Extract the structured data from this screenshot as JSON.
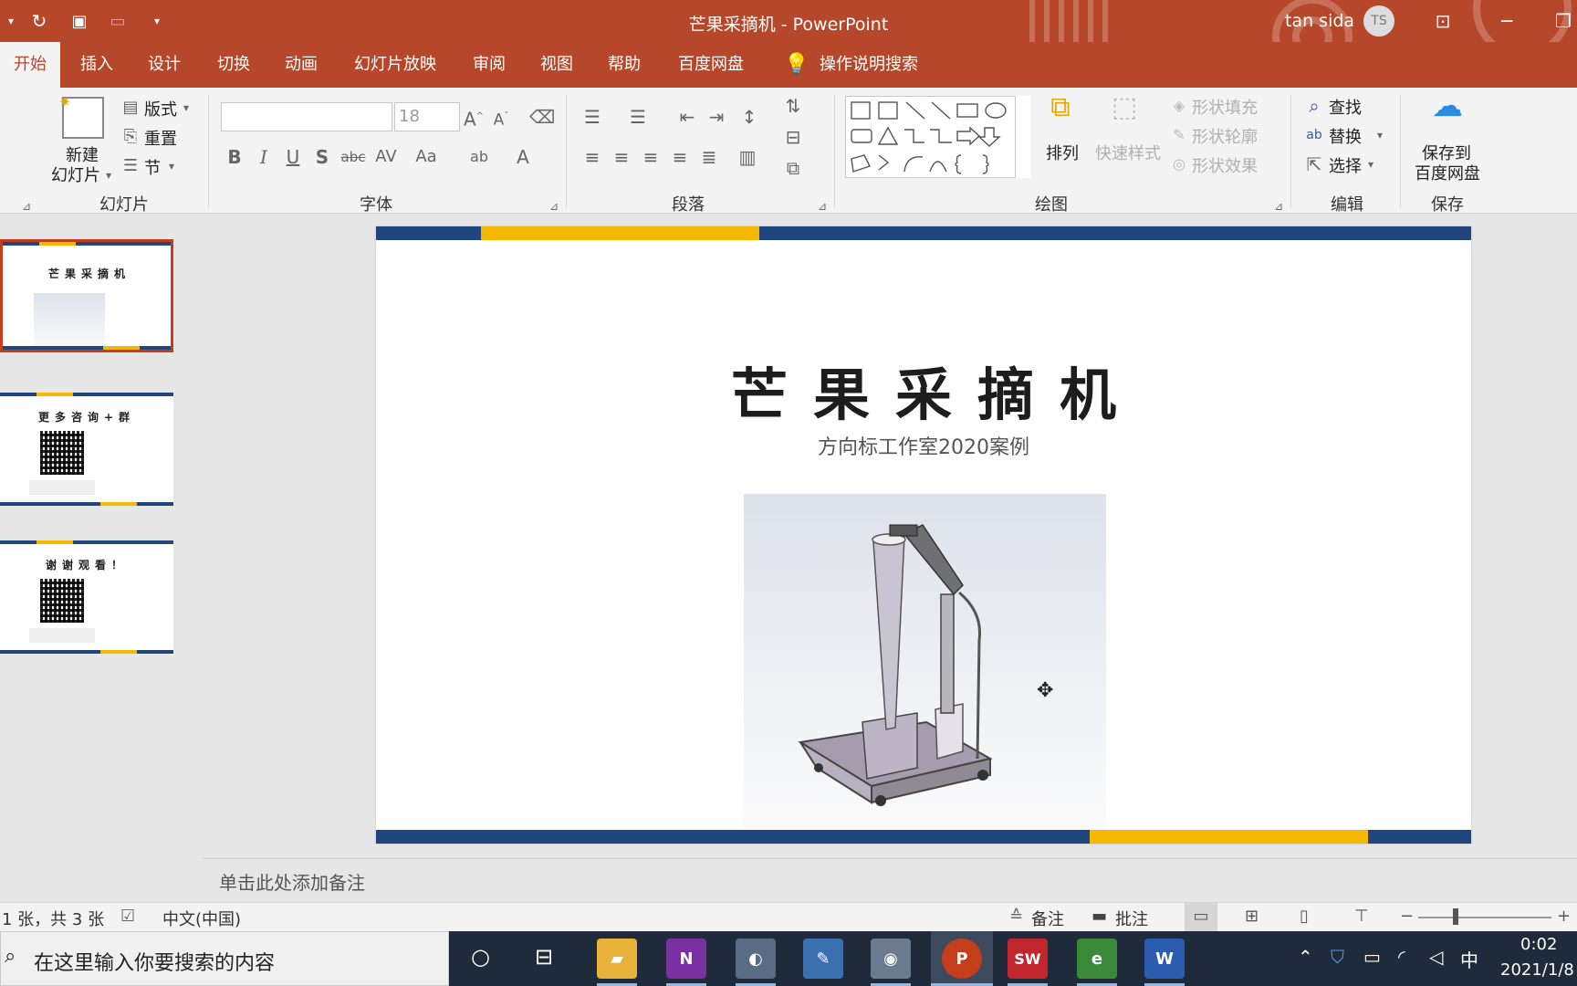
{
  "window": {
    "doc_title": "芒果采摘机 - PowerPoint",
    "user_name": "tan sida",
    "avatar_initials": "TS"
  },
  "tabs": [
    "开始",
    "插入",
    "设计",
    "切换",
    "动画",
    "幻灯片放映",
    "审阅",
    "视图",
    "帮助",
    "百度网盘",
    "操作说明搜索"
  ],
  "ribbon": {
    "slides": {
      "new_slide_l1": "新建",
      "new_slide_l2": "幻灯片",
      "layout": "版式",
      "reset": "重置",
      "section": "节",
      "group": "幻灯片"
    },
    "font": {
      "size": "18",
      "group": "字体"
    },
    "paragraph": {
      "group": "段落"
    },
    "drawing": {
      "arrange": "排列",
      "quick_styles": "快速样式",
      "fill": "形状填充",
      "outline": "形状轮廓",
      "effects": "形状效果",
      "group": "绘图"
    },
    "editing": {
      "find": "查找",
      "replace": "替换",
      "select": "选择",
      "group": "编辑"
    },
    "save": {
      "l1": "保存到",
      "l2": "百度网盘",
      "group": "保存"
    }
  },
  "thumbnails": [
    {
      "title": "芒果采摘机"
    },
    {
      "title": "更多咨询+群"
    },
    {
      "title": "谢谢观看！"
    }
  ],
  "slide": {
    "title": "芒果采摘机",
    "subtitle": "方向标工作室2020案例"
  },
  "notes_placeholder": "单击此处添加备注",
  "status": {
    "slide_count": "1 张，共 3 张",
    "language": "中文(中国)",
    "notes": "备注",
    "comments": "批注"
  },
  "taskbar": {
    "search_placeholder": "在这里输入你要搜索的内容",
    "ime": "中",
    "time": "0:02",
    "date": "2021/1/8"
  },
  "colors": {
    "accent": "#b7472a",
    "slide_blue": "#1f477d",
    "slide_yellow": "#f5b800"
  }
}
